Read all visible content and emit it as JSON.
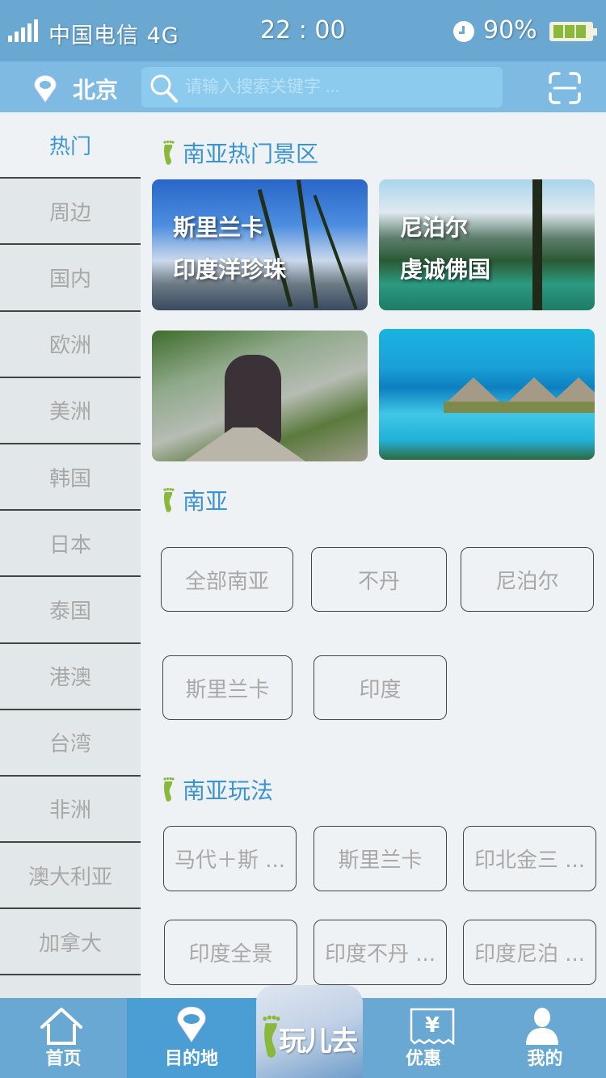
{
  "status_bar": {
    "carrier": "中国电信 4G",
    "time": "22 : 00",
    "battery_percent": "90%",
    "battery_level": 0.9
  },
  "top_nav": {
    "city": "北京",
    "search_placeholder": "请输入搜索关键字 ...",
    "search_value": "",
    "icons": {
      "location": "location-pin-icon",
      "search": "search-icon",
      "scan": "scan-icon"
    }
  },
  "sidebar": {
    "items": [
      {
        "label": "热门",
        "active": true
      },
      {
        "label": "周边"
      },
      {
        "label": "国内"
      },
      {
        "label": "欧洲"
      },
      {
        "label": "美洲"
      },
      {
        "label": "韩国"
      },
      {
        "label": "日本"
      },
      {
        "label": "泰国"
      },
      {
        "label": "港澳"
      },
      {
        "label": "台湾"
      },
      {
        "label": "非洲"
      },
      {
        "label": "澳大利亚"
      },
      {
        "label": "加拿大"
      }
    ]
  },
  "main": {
    "hot_section": {
      "title": "南亚热门景区",
      "cards": [
        {
          "line1": "斯里兰卡",
          "line2": "印度洋珍珠",
          "image": "palm-beach"
        },
        {
          "line1": "尼泊尔",
          "line2": "虔诚佛国",
          "image": "mountain-lake"
        },
        {
          "line1": "",
          "line2": "",
          "image": "elephant-road"
        },
        {
          "line1": "",
          "line2": "",
          "image": "overwater-bungalows"
        }
      ]
    },
    "region_section": {
      "title": "南亚",
      "tags": [
        "全部南亚",
        "不丹",
        "尼泊尔",
        "斯里兰卡",
        "印度"
      ]
    },
    "play_section": {
      "title": "南亚玩法",
      "tags": [
        "马代＋斯 ...",
        "斯里兰卡",
        "印北金三 ...",
        "印度全景",
        "印度不丹 ...",
        "印度尼泊 ..."
      ]
    }
  },
  "tab_bar": {
    "tabs": [
      {
        "label": "首页",
        "icon": "home-icon"
      },
      {
        "label": "目的地",
        "icon": "location-pin-icon",
        "active": true
      },
      {
        "label": "玩儿去",
        "icon": "footprint-icon"
      },
      {
        "label": "优惠",
        "icon": "coupon-yen-icon"
      },
      {
        "label": "我的",
        "icon": "user-icon"
      }
    ]
  },
  "colors": {
    "status_bar": "#6aa7d1",
    "nav_bar": "#7ebae2",
    "accent_blue": "#3b93cf",
    "footprint_green": "#8ab83b",
    "tab_active": "#4a9ed4",
    "inactive_text": "#a8a8a8"
  }
}
